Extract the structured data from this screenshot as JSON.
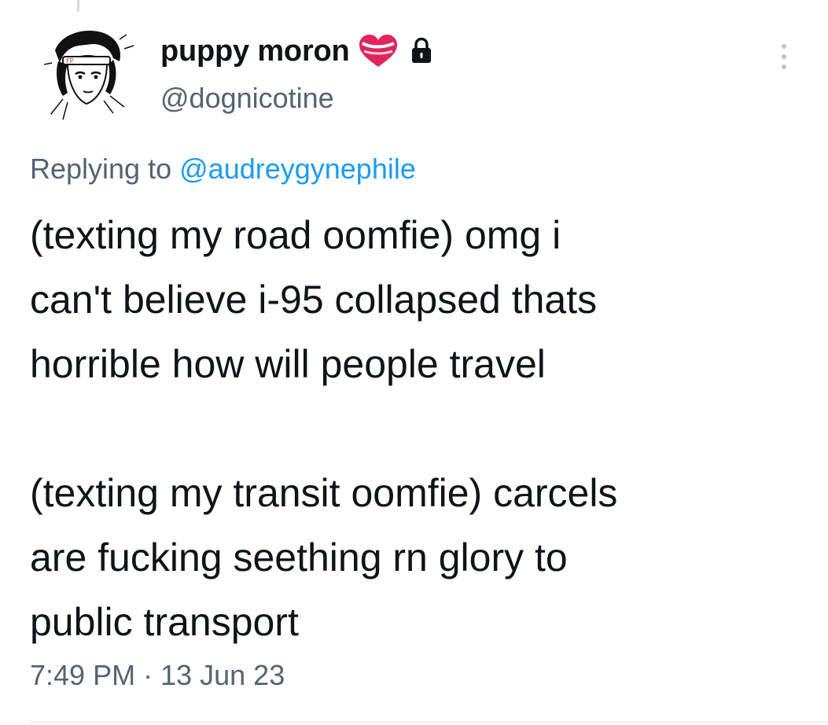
{
  "author": {
    "display_name": "puppy moron",
    "handle": "@dognicotine",
    "badge_icon": "heart-icon",
    "protected_icon": "lock-icon",
    "avatar_icon": "avatar-drawing"
  },
  "reply": {
    "prefix": "Replying to",
    "mention": "@audreygynephile"
  },
  "tweet": {
    "lines": [
      "(texting my road oomfie) omg i",
      "can't believe i-95 collapsed thats",
      "horrible how will people travel",
      "",
      "(texting my transit oomfie) carcels",
      "are fucking seething rn glory to",
      "public transport"
    ]
  },
  "meta": {
    "time": "7:49 PM",
    "separator": "·",
    "date": "13 Jun 23"
  },
  "colors": {
    "text_primary": "#0f1419",
    "text_secondary": "#536471",
    "link": "#1d9bf0",
    "heart_red": "#e0245e"
  }
}
